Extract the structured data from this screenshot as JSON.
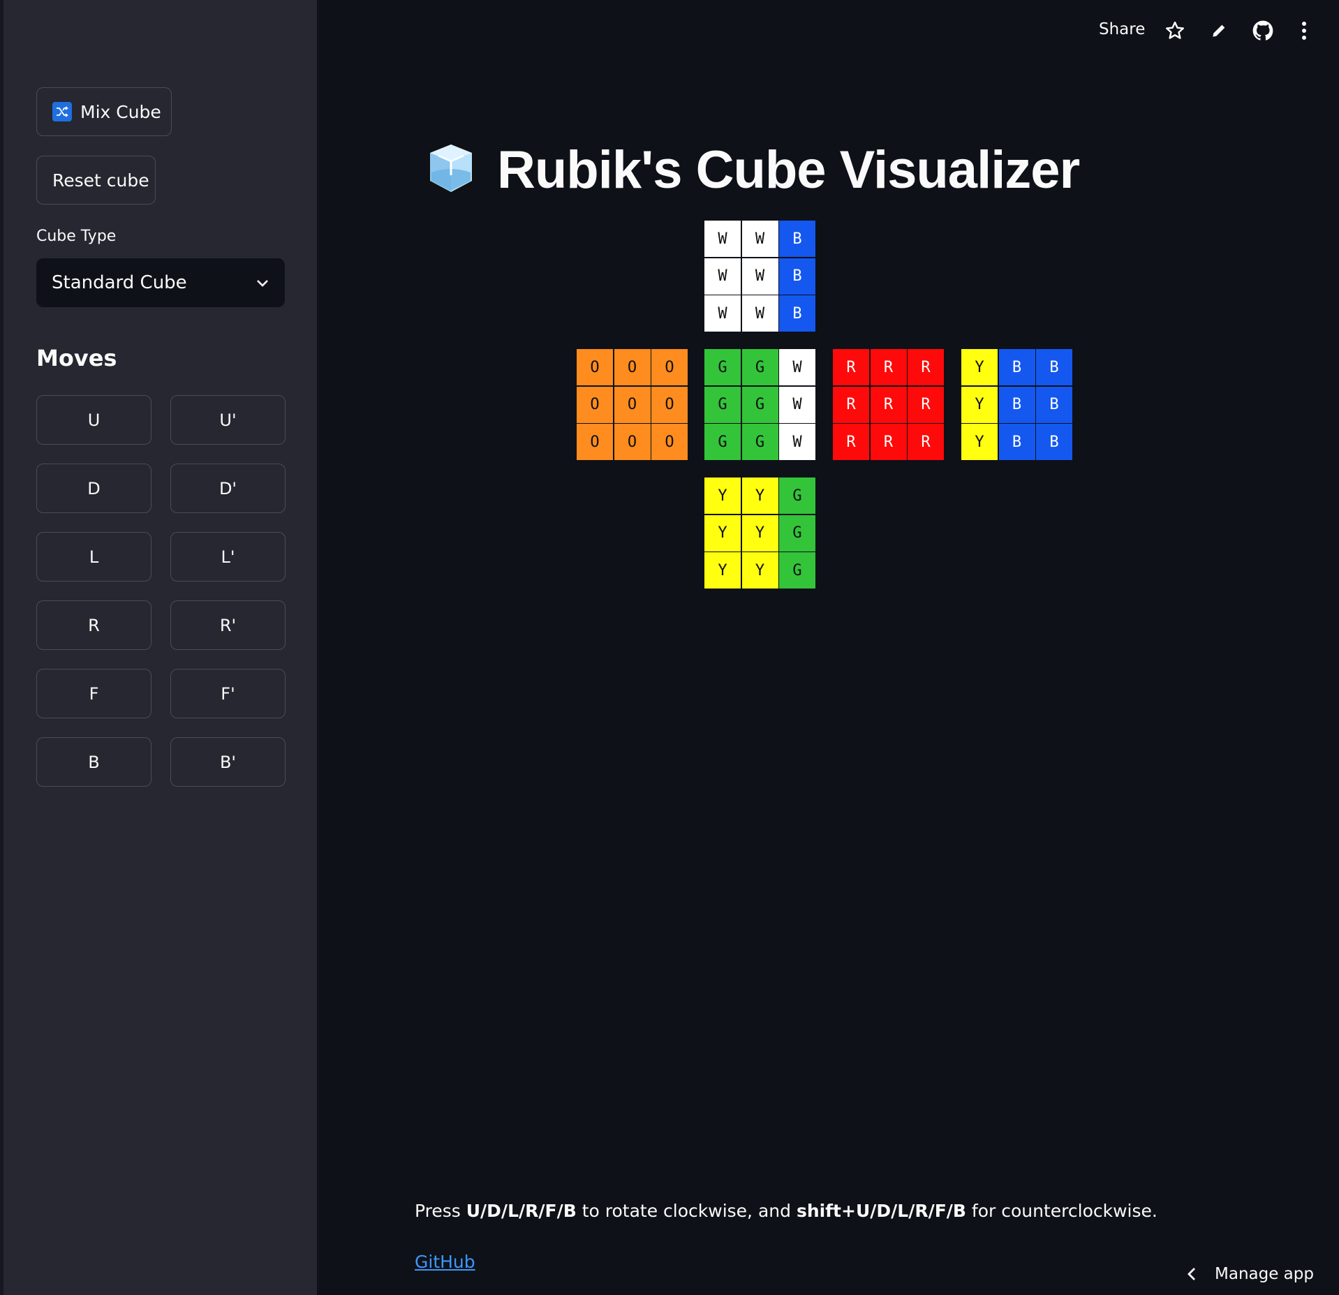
{
  "sidebar": {
    "mix_cube_label": "Mix Cube",
    "reset_cube_label": "Reset cube",
    "cube_type_label": "Cube Type",
    "cube_type_selected": "Standard Cube",
    "moves_heading": "Moves",
    "moves": [
      "U",
      "U'",
      "D",
      "D'",
      "L",
      "L'",
      "R",
      "R'",
      "F",
      "F'",
      "B",
      "B'"
    ]
  },
  "header": {
    "share_label": "Share",
    "icons": [
      "star-icon",
      "pencil-icon",
      "github-icon",
      "more-vertical-icon"
    ]
  },
  "main": {
    "title": "Rubik's Cube Visualizer",
    "title_icon": "ice-cube-icon",
    "cube_faces": {
      "top": [
        "W",
        "W",
        "B",
        "W",
        "W",
        "B",
        "W",
        "W",
        "B"
      ],
      "left": [
        "O",
        "O",
        "O",
        "O",
        "O",
        "O",
        "O",
        "O",
        "O"
      ],
      "front": [
        "G",
        "G",
        "W",
        "G",
        "G",
        "W",
        "G",
        "G",
        "W"
      ],
      "right": [
        "R",
        "R",
        "R",
        "R",
        "R",
        "R",
        "R",
        "R",
        "R"
      ],
      "back": [
        "Y",
        "B",
        "B",
        "Y",
        "B",
        "B",
        "Y",
        "B",
        "B"
      ],
      "bottom": [
        "Y",
        "Y",
        "G",
        "Y",
        "Y",
        "G",
        "Y",
        "Y",
        "G"
      ]
    },
    "colors": {
      "W": "#ffffff",
      "B": "#1458f0",
      "O": "#ff8c1e",
      "G": "#33c43a",
      "R": "#ff0a0a",
      "Y": "#ffff0f"
    },
    "instructions": {
      "part1": "Press ",
      "keys_cw": "U/D/L/R/F/B",
      "part2": " to rotate clockwise, and ",
      "keys_ccw": "shift+U/D/L/R/F/B",
      "part3": " for counterclockwise."
    },
    "github_link": "GitHub"
  },
  "footer": {
    "manage_app_label": "Manage app"
  }
}
